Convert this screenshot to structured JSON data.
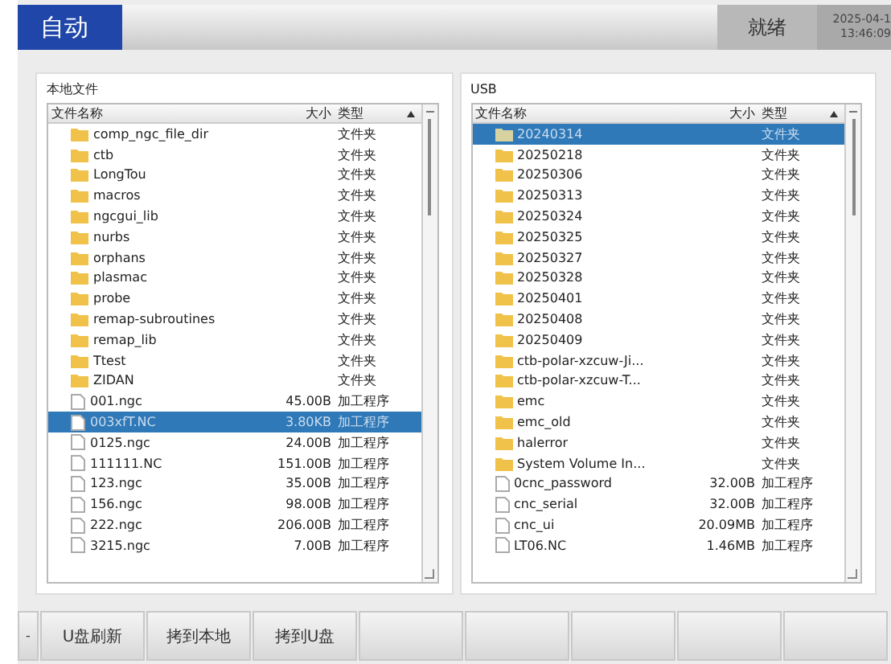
{
  "header": {
    "mode": "自动",
    "status": "就绪",
    "date": "2025-04-1",
    "time": "13:46:09"
  },
  "panels": [
    {
      "title": "本地文件",
      "columns": [
        "文件名称",
        "大小",
        "类型"
      ],
      "rows": [
        {
          "kind": "folder",
          "name": "comp_ngc_file_dir",
          "type": "文件夹",
          "selected": false
        },
        {
          "kind": "folder",
          "name": "ctb",
          "type": "文件夹",
          "selected": false
        },
        {
          "kind": "folder",
          "name": "LongTou",
          "type": "文件夹",
          "selected": false
        },
        {
          "kind": "folder",
          "name": "macros",
          "type": "文件夹",
          "selected": false
        },
        {
          "kind": "folder",
          "name": "ngcgui_lib",
          "type": "文件夹",
          "selected": false
        },
        {
          "kind": "folder",
          "name": "nurbs",
          "type": "文件夹",
          "selected": false
        },
        {
          "kind": "folder",
          "name": "orphans",
          "type": "文件夹",
          "selected": false
        },
        {
          "kind": "folder",
          "name": "plasmac",
          "type": "文件夹",
          "selected": false
        },
        {
          "kind": "folder",
          "name": "probe",
          "type": "文件夹",
          "selected": false
        },
        {
          "kind": "folder",
          "name": "remap-subroutines",
          "type": "文件夹",
          "selected": false
        },
        {
          "kind": "folder",
          "name": "remap_lib",
          "type": "文件夹",
          "selected": false
        },
        {
          "kind": "folder",
          "name": "Ttest",
          "type": "文件夹",
          "selected": false
        },
        {
          "kind": "folder",
          "name": "ZIDAN",
          "type": "文件夹",
          "selected": false
        },
        {
          "kind": "file",
          "name": "001.ngc",
          "size": "45.00B",
          "type": "加工程序",
          "selected": false
        },
        {
          "kind": "file",
          "name": "003xfT.NC",
          "size": "3.80KB",
          "type": "加工程序",
          "selected": true
        },
        {
          "kind": "file",
          "name": "0125.ngc",
          "size": "24.00B",
          "type": "加工程序",
          "selected": false
        },
        {
          "kind": "file",
          "name": "111111.NC",
          "size": "151.00B",
          "type": "加工程序",
          "selected": false
        },
        {
          "kind": "file",
          "name": "123.ngc",
          "size": "35.00B",
          "type": "加工程序",
          "selected": false
        },
        {
          "kind": "file",
          "name": "156.ngc",
          "size": "98.00B",
          "type": "加工程序",
          "selected": false
        },
        {
          "kind": "file",
          "name": "222.ngc",
          "size": "206.00B",
          "type": "加工程序",
          "selected": false
        },
        {
          "kind": "file",
          "name": "3215.ngc",
          "size": "7.00B",
          "type": "加工程序",
          "selected": false
        }
      ]
    },
    {
      "title": "USB",
      "columns": [
        "文件名称",
        "大小",
        "类型"
      ],
      "rows": [
        {
          "kind": "folder",
          "name": "20240314",
          "type": "文件夹",
          "selected": true
        },
        {
          "kind": "folder",
          "name": "20250218",
          "type": "文件夹",
          "selected": false
        },
        {
          "kind": "folder",
          "name": "20250306",
          "type": "文件夹",
          "selected": false
        },
        {
          "kind": "folder",
          "name": "20250313",
          "type": "文件夹",
          "selected": false
        },
        {
          "kind": "folder",
          "name": "20250324",
          "type": "文件夹",
          "selected": false
        },
        {
          "kind": "folder",
          "name": "20250325",
          "type": "文件夹",
          "selected": false
        },
        {
          "kind": "folder",
          "name": "20250327",
          "type": "文件夹",
          "selected": false
        },
        {
          "kind": "folder",
          "name": "20250328",
          "type": "文件夹",
          "selected": false
        },
        {
          "kind": "folder",
          "name": "20250401",
          "type": "文件夹",
          "selected": false
        },
        {
          "kind": "folder",
          "name": "20250408",
          "type": "文件夹",
          "selected": false
        },
        {
          "kind": "folder",
          "name": "20250409",
          "type": "文件夹",
          "selected": false
        },
        {
          "kind": "folder",
          "name": "ctb-polar-xzcuw-Ji...",
          "type": "文件夹",
          "selected": false
        },
        {
          "kind": "folder",
          "name": "ctb-polar-xzcuw-T...",
          "type": "文件夹",
          "selected": false
        },
        {
          "kind": "folder",
          "name": "emc",
          "type": "文件夹",
          "selected": false
        },
        {
          "kind": "folder",
          "name": "emc_old",
          "type": "文件夹",
          "selected": false
        },
        {
          "kind": "folder",
          "name": "halerror",
          "type": "文件夹",
          "selected": false
        },
        {
          "kind": "folder",
          "name": "System Volume In...",
          "type": "文件夹",
          "selected": false
        },
        {
          "kind": "file",
          "name": "0cnc_password",
          "size": "32.00B",
          "type": "加工程序",
          "selected": false
        },
        {
          "kind": "file",
          "name": "cnc_serial",
          "size": "32.00B",
          "type": "加工程序",
          "selected": false
        },
        {
          "kind": "file",
          "name": "cnc_ui",
          "size": "20.09MB",
          "type": "加工程序",
          "selected": false
        },
        {
          "kind": "file",
          "name": "LT06.NC",
          "size": "1.46MB",
          "type": "加工程序",
          "selected": false
        }
      ]
    }
  ],
  "toolbar": {
    "collapse": "-",
    "buttons": [
      "U盘刷新",
      "拷到本地",
      "拷到U盘"
    ]
  }
}
